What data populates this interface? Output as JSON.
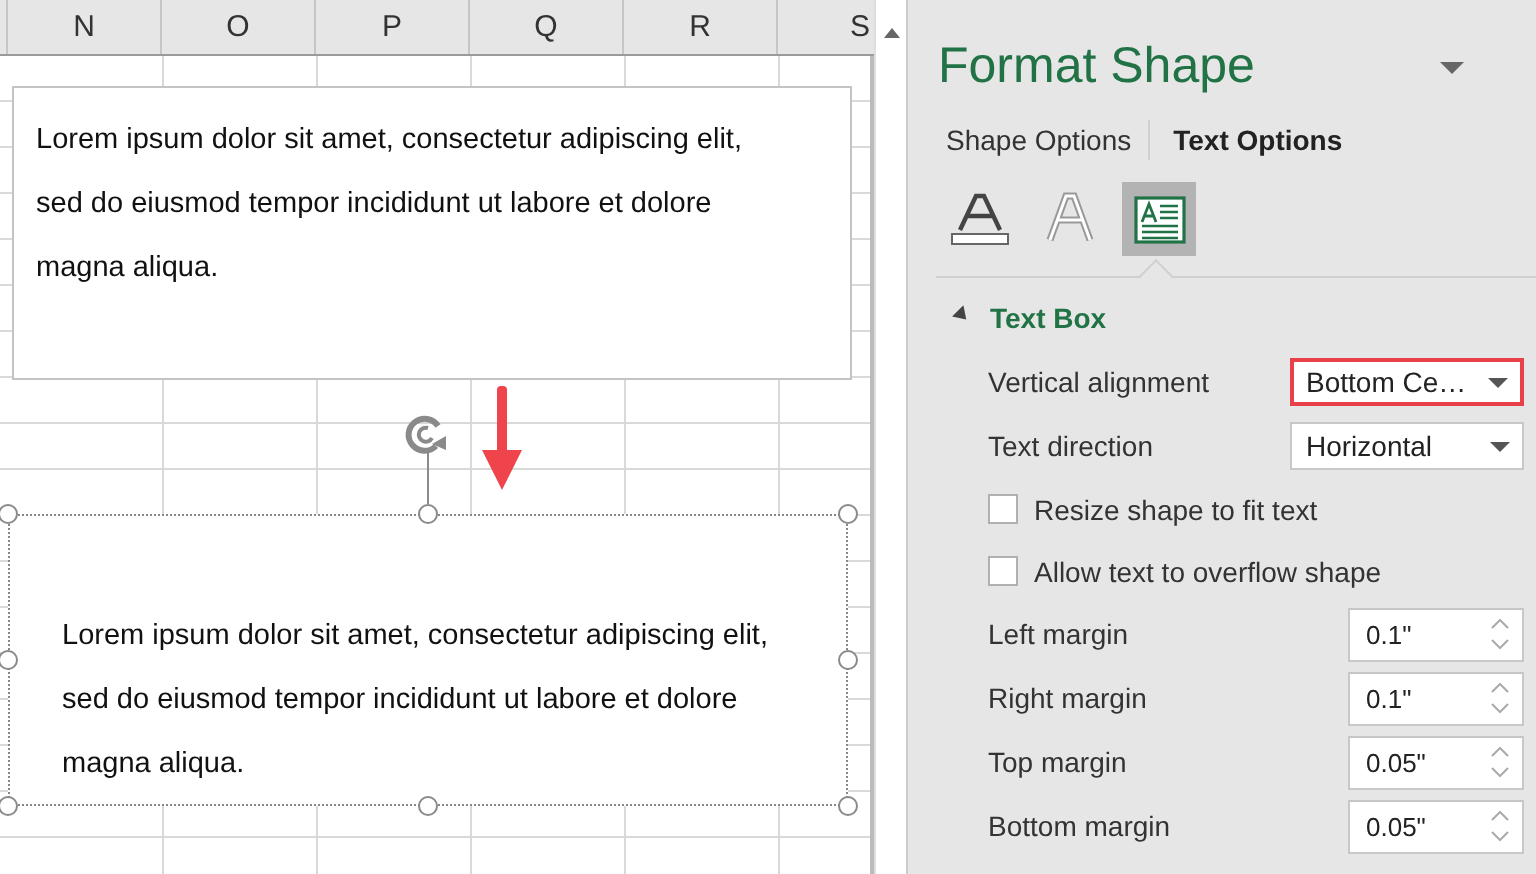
{
  "sheet": {
    "columns": [
      "N",
      "O",
      "P",
      "Q",
      "R",
      "S"
    ],
    "shapes": [
      {
        "text": "Lorem ipsum dolor sit amet, consectetur adipiscing elit, sed do eiusmod tempor incididunt ut labore et dolore magna aliqua.",
        "selected": false
      },
      {
        "text": "Lorem ipsum dolor sit amet, consectetur adipiscing elit, sed do eiusmod tempor incididunt ut labore et dolore magna aliqua.",
        "selected": true
      }
    ]
  },
  "panel": {
    "title": "Format Shape",
    "tabs": [
      {
        "label": "Shape Options",
        "selected": false
      },
      {
        "label": "Text Options",
        "selected": true
      }
    ],
    "icon_tabs": [
      {
        "kind": "text-fill",
        "selected": false
      },
      {
        "kind": "text-effects",
        "selected": false
      },
      {
        "kind": "textbox",
        "selected": true
      }
    ],
    "section": {
      "title": "Text Box",
      "expanded": true,
      "rows": [
        {
          "kind": "select",
          "label": "Vertical alignment",
          "value": "Bottom Ce…",
          "highlighted": true
        },
        {
          "kind": "select",
          "label": "Text direction",
          "value": "Horizontal",
          "highlighted": false
        },
        {
          "kind": "checkbox",
          "label": "Resize shape to fit text",
          "checked": false
        },
        {
          "kind": "checkbox",
          "label": "Allow text to overflow shape",
          "checked": false
        },
        {
          "kind": "spin",
          "label": "Left margin",
          "value": "0.1\""
        },
        {
          "kind": "spin",
          "label": "Right margin",
          "value": "0.1\""
        },
        {
          "kind": "spin",
          "label": "Top margin",
          "value": "0.05\""
        },
        {
          "kind": "spin",
          "label": "Bottom margin",
          "value": "0.05\""
        }
      ]
    }
  }
}
